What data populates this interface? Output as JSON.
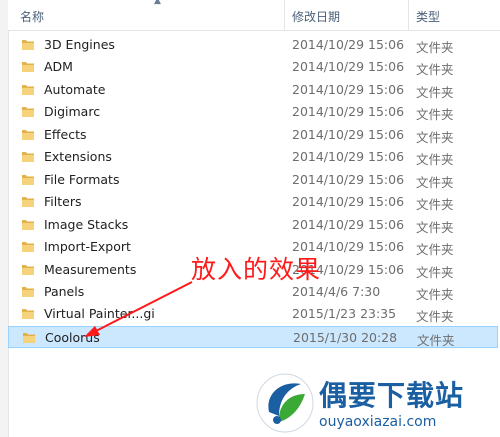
{
  "columns": {
    "name": "名称",
    "date": "修改日期",
    "type": "类型"
  },
  "folders": [
    {
      "name": "3D Engines",
      "date": "2014/10/29 15:06",
      "type": "文件夹"
    },
    {
      "name": "ADM",
      "date": "2014/10/29 15:06",
      "type": "文件夹"
    },
    {
      "name": "Automate",
      "date": "2014/10/29 15:06",
      "type": "文件夹"
    },
    {
      "name": "Digimarc",
      "date": "2014/10/29 15:06",
      "type": "文件夹"
    },
    {
      "name": "Effects",
      "date": "2014/10/29 15:06",
      "type": "文件夹"
    },
    {
      "name": "Extensions",
      "date": "2014/10/29 15:06",
      "type": "文件夹"
    },
    {
      "name": "File Formats",
      "date": "2014/10/29 15:06",
      "type": "文件夹"
    },
    {
      "name": "Filters",
      "date": "2014/10/29 15:06",
      "type": "文件夹"
    },
    {
      "name": "Image Stacks",
      "date": "2014/10/29 15:06",
      "type": "文件夹"
    },
    {
      "name": "Import-Export",
      "date": "2014/10/29 15:06",
      "type": "文件夹"
    },
    {
      "name": "Measurements",
      "date": "2014/10/29 15:06",
      "type": "文件夹"
    },
    {
      "name": "Panels",
      "date": "2014/4/6 7:30",
      "type": "文件夹"
    },
    {
      "name": "Virtual Painter...gi",
      "date": "2015/1/23 23:35",
      "type": "文件夹"
    },
    {
      "name": "Coolorus",
      "date": "2015/1/30 20:28",
      "type": "文件夹",
      "selected": true
    }
  ],
  "annotation": "放入的效果",
  "watermark": {
    "title": "偶要下载站",
    "url": "ouyaoxiazai.com"
  },
  "colors": {
    "selected_bg": "#cce8ff",
    "annotation": "#ff1a1a",
    "folder": "#e8b84a",
    "watermark": "#1b5fa3"
  }
}
